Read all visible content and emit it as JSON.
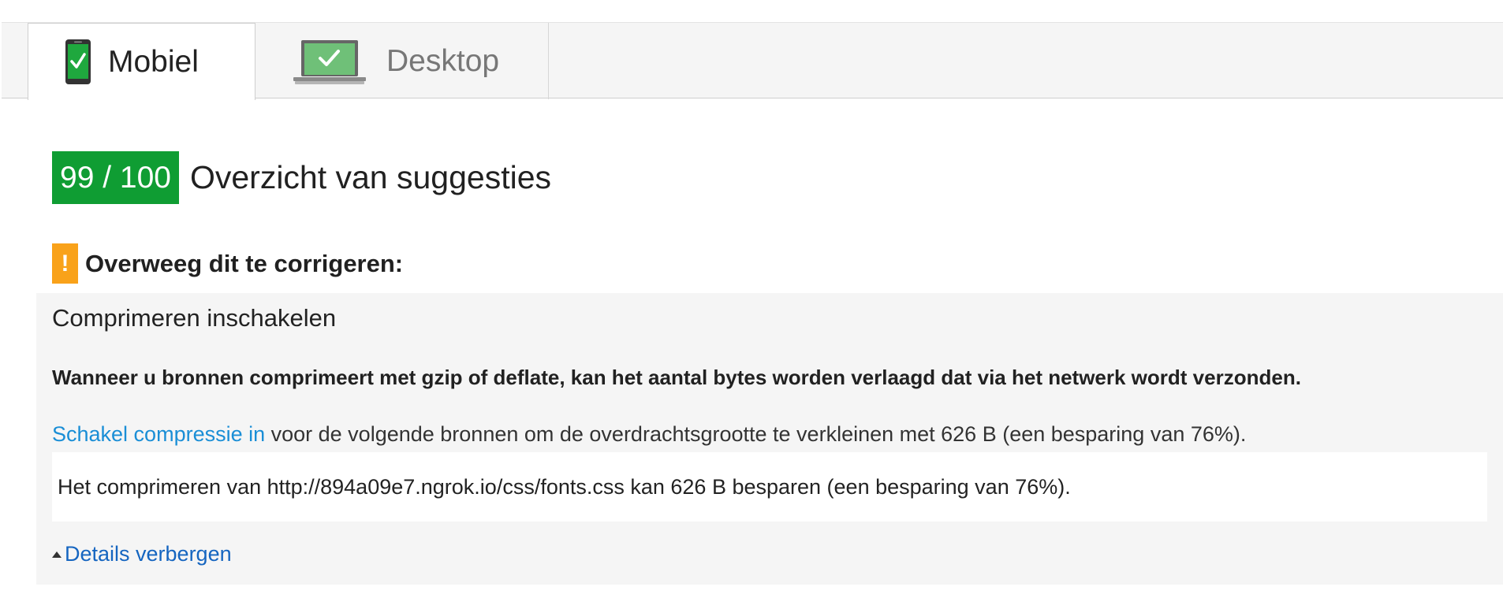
{
  "tabs": [
    {
      "label": "Mobiel",
      "icon": "mobile-phone-check-icon",
      "active": true
    },
    {
      "label": "Desktop",
      "icon": "laptop-check-icon",
      "active": false
    }
  ],
  "score": {
    "value": "99 / 100",
    "title": "Overzicht van suggesties",
    "color": "#0f9d33"
  },
  "consider": {
    "icon": "warning-icon",
    "icon_glyph": "!",
    "title": "Overweeg dit te corrigeren:",
    "color": "#f9a21a"
  },
  "rule": {
    "title": "Comprimeren inschakelen",
    "summary": "Wanneer u bronnen comprimeert met gzip of deflate, kan het aantal bytes worden verlaagd dat via het netwerk wordt verzonden.",
    "link_text": "Schakel compressie in",
    "detail_text": " voor de volgende bronnen om de overdrachtsgrootte te verkleinen met 626 B (een besparing van 76%).",
    "urls": [
      "Het comprimeren van http://894a09e7.ngrok.io/css/fonts.css kan 626 B besparen (een besparing van 76%)."
    ],
    "toggle_label": "Details verbergen",
    "link_color": "#1a8ed6"
  }
}
